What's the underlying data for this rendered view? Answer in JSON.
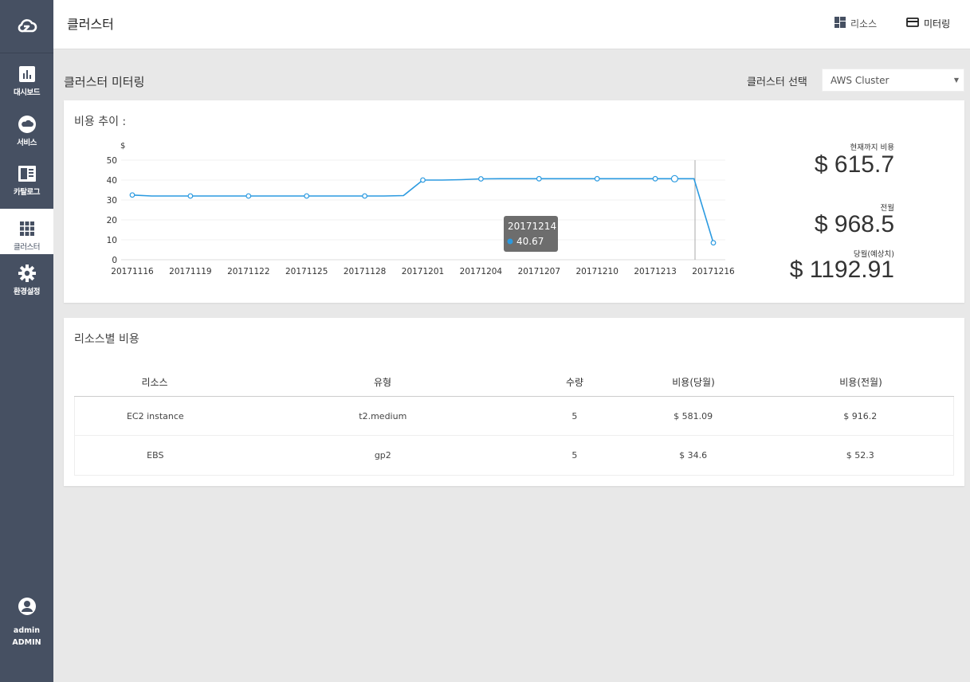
{
  "sidebar": {
    "items": [
      {
        "label": "대시보드",
        "icon": "dashboard-icon"
      },
      {
        "label": "서비스",
        "icon": "cloud-icon"
      },
      {
        "label": "카탈로그",
        "icon": "catalog-icon"
      },
      {
        "label": "클러스터",
        "icon": "grid-icon"
      },
      {
        "label": "환경설정",
        "icon": "gear-icon"
      }
    ],
    "user": {
      "name": "admin",
      "role": "ADMIN"
    }
  },
  "header": {
    "title": "클러스터",
    "resource_label": "리소스",
    "metering_label": "미터링"
  },
  "section": {
    "title": "클러스터 미터링",
    "select_label": "클러스터 선택",
    "select_value": "AWS Cluster"
  },
  "trend": {
    "title": "비용 추이 :",
    "tooltip_date": "20171214",
    "tooltip_value": "40.67"
  },
  "costs": {
    "to_date_label": "현재까지 비용",
    "to_date_value": "$ 615.7",
    "prev_label": "전월",
    "prev_value": "$ 968.5",
    "forecast_label": "당월(예상치)",
    "forecast_value": "$ 1192.91"
  },
  "resources": {
    "title": "리소스별 비용",
    "headers": [
      "리소스",
      "유형",
      "수량",
      "비용(당월)",
      "비용(전월)"
    ],
    "rows": [
      [
        "EC2 instance",
        "t2.medium",
        "5",
        "$ 581.09",
        "$ 916.2"
      ],
      [
        "EBS",
        "gp2",
        "5",
        "$ 34.6",
        "$ 52.3"
      ]
    ]
  },
  "chart_data": {
    "type": "line",
    "ylabel": "$",
    "ylim": [
      0,
      50
    ],
    "yticks": [
      0,
      10,
      20,
      30,
      40,
      50
    ],
    "xticks": [
      "20171116",
      "20171119",
      "20171122",
      "20171125",
      "20171128",
      "20171201",
      "20171204",
      "20171207",
      "20171210",
      "20171213",
      "20171216"
    ],
    "x": [
      "20171116",
      "20171117",
      "20171118",
      "20171119",
      "20171120",
      "20171121",
      "20171122",
      "20171123",
      "20171124",
      "20171125",
      "20171126",
      "20171127",
      "20171128",
      "20171129",
      "20171130",
      "20171201",
      "20171202",
      "20171203",
      "20171204",
      "20171205",
      "20171206",
      "20171207",
      "20171208",
      "20171209",
      "20171210",
      "20171211",
      "20171212",
      "20171213",
      "20171214",
      "20171215",
      "20171216"
    ],
    "series": [
      {
        "values": [
          32.5,
          32.0,
          32.0,
          32.0,
          32.0,
          32.0,
          32.0,
          32.0,
          32.0,
          32.0,
          32.0,
          32.0,
          32.0,
          32.0,
          32.2,
          40.0,
          40.0,
          40.2,
          40.6,
          40.67,
          40.67,
          40.67,
          40.67,
          40.67,
          40.67,
          40.67,
          40.67,
          40.67,
          40.67,
          40.67,
          8.5
        ]
      }
    ],
    "color": "#2b9ae0",
    "grid": true
  }
}
